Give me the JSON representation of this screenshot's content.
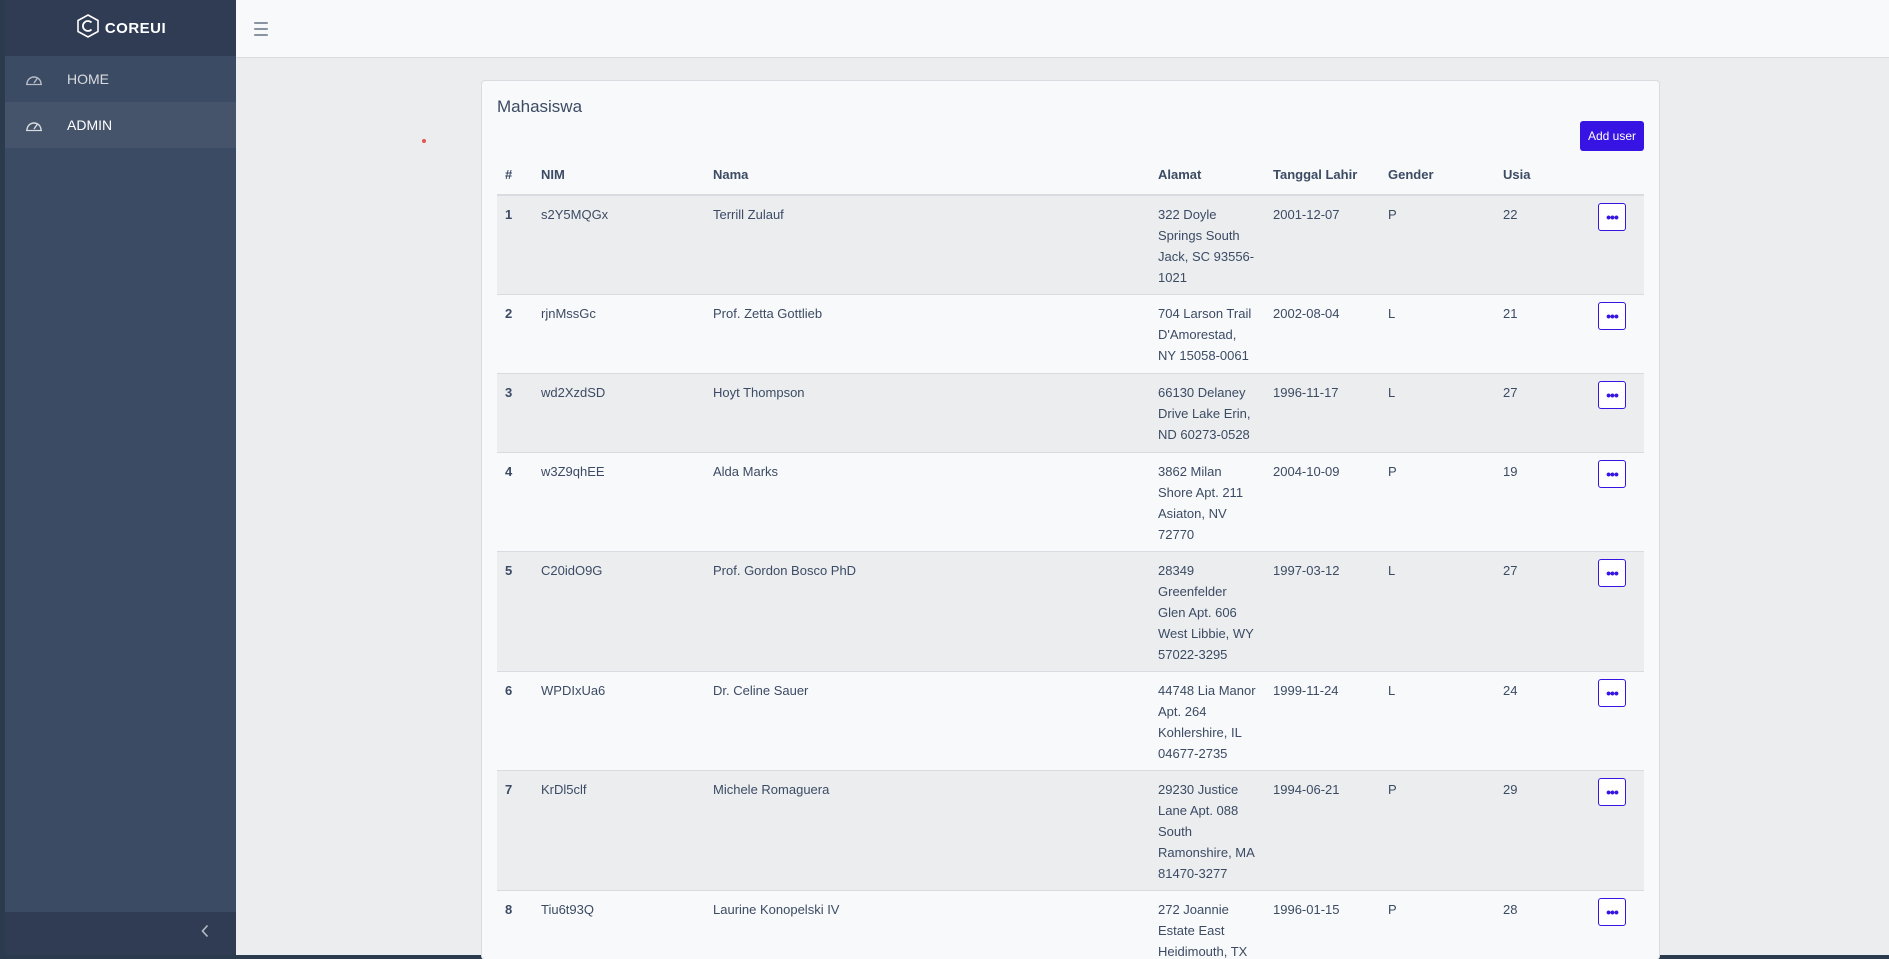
{
  "brand": {
    "name": "COREUI"
  },
  "sidebar": {
    "items": [
      {
        "label": "HOME",
        "icon": "speedometer-icon"
      },
      {
        "label": "ADMIN",
        "icon": "speedometer-icon"
      }
    ],
    "toggler_icon": "chevron-left-icon"
  },
  "header": {
    "menu_icon": "hamburger-icon"
  },
  "card": {
    "title": "Mahasiswa",
    "add_user_label": "Add user"
  },
  "table": {
    "headers": [
      "#",
      "NIM",
      "Nama",
      "Alamat",
      "Tanggal Lahir",
      "Gender",
      "Usia"
    ],
    "rows": [
      {
        "no": "1",
        "nim": "s2Y5MQGx",
        "nama": "Terrill Zulauf",
        "alamat": "322 Doyle Springs South Jack, SC 93556-1021",
        "tgl": "2001-12-07",
        "gender": "P",
        "usia": "22"
      },
      {
        "no": "2",
        "nim": "rjnMssGc",
        "nama": "Prof. Zetta Gottlieb",
        "alamat": "704 Larson Trail D'Amorestad, NY 15058-0061",
        "tgl": "2002-08-04",
        "gender": "L",
        "usia": "21"
      },
      {
        "no": "3",
        "nim": "wd2XzdSD",
        "nama": "Hoyt Thompson",
        "alamat": "66130 Delaney Drive Lake Erin, ND 60273-0528",
        "tgl": "1996-11-17",
        "gender": "L",
        "usia": "27"
      },
      {
        "no": "4",
        "nim": "w3Z9qhEE",
        "nama": "Alda Marks",
        "alamat": "3862 Milan Shore Apt. 211 Asiaton, NV 72770",
        "tgl": "2004-10-09",
        "gender": "P",
        "usia": "19"
      },
      {
        "no": "5",
        "nim": "C20idO9G",
        "nama": "Prof. Gordon Bosco PhD",
        "alamat": "28349 Greenfelder Glen Apt. 606 West Libbie, WY 57022-3295",
        "tgl": "1997-03-12",
        "gender": "L",
        "usia": "27"
      },
      {
        "no": "6",
        "nim": "WPDIxUa6",
        "nama": "Dr. Celine Sauer",
        "alamat": "44748 Lia Manor Apt. 264 Kohlershire, IL 04677-2735",
        "tgl": "1999-11-24",
        "gender": "L",
        "usia": "24"
      },
      {
        "no": "7",
        "nim": "KrDl5clf",
        "nama": "Michele Romaguera",
        "alamat": "29230 Justice Lane Apt. 088 South Ramonshire, MA 81470-3277",
        "tgl": "1994-06-21",
        "gender": "P",
        "usia": "29"
      },
      {
        "no": "8",
        "nim": "Tiu6t93Q",
        "nama": "Laurine Konopelski IV",
        "alamat": "272 Joannie Estate East Heidimouth, TX",
        "tgl": "1996-01-15",
        "gender": "P",
        "usia": "28"
      }
    ],
    "action_icon": "more-horizontal-icon",
    "action_label": "•••"
  },
  "colors": {
    "sidebar": "#3c4b64",
    "sidebar_brand": "#303c54",
    "primary": "#3714e4",
    "background": "#ebedef"
  }
}
